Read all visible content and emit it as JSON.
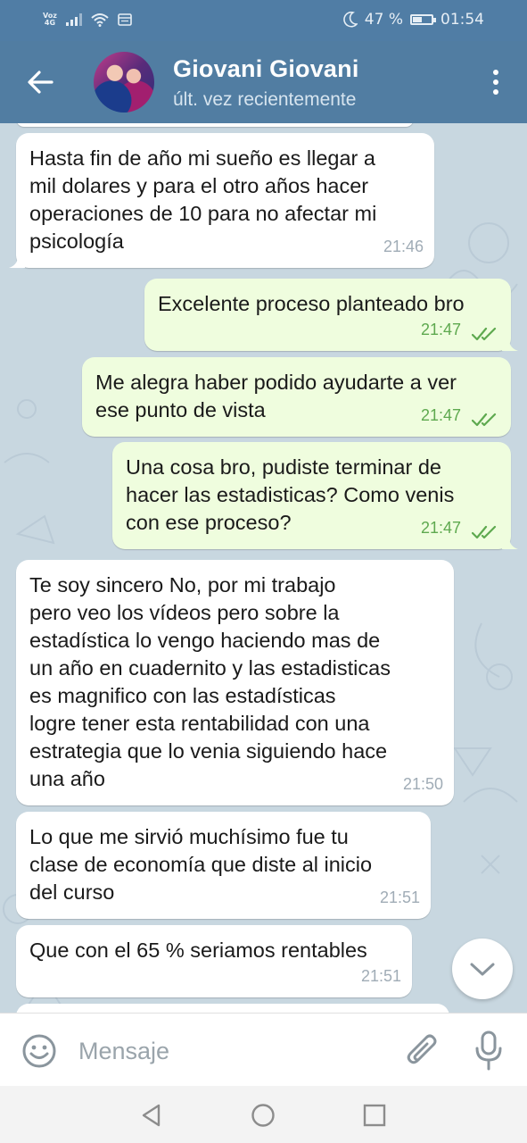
{
  "status_bar": {
    "volte_top": "Voz",
    "volte_bottom": "4G",
    "battery": "47 %",
    "time": "01:54"
  },
  "header": {
    "contact_name": "Giovani Giovani",
    "last_seen": "últ. vez recientemente"
  },
  "messages": [
    {
      "direction": "in",
      "text": "Hasta fin de año mi sueño es llegar a\nmil dolares y para el otro años hacer\noperaciones de 10 para no afectar mi\npsicología",
      "time": "21:46"
    },
    {
      "direction": "out",
      "text": "Excelente proceso planteado bro",
      "time": "21:47",
      "status": "read"
    },
    {
      "direction": "out",
      "text": "Me alegra haber podido ayudarte a ver\nese punto de vista",
      "time": "21:47",
      "status": "read"
    },
    {
      "direction": "out",
      "text": "Una cosa bro, pudiste terminar de\nhacer las estadisticas? Como venis\ncon ese proceso?",
      "time": "21:47",
      "status": "read"
    },
    {
      "direction": "in",
      "text": "Te soy sincero No, por mi trabajo\npero veo los vídeos pero sobre la\nestadística lo vengo haciendo mas de\nun año en cuadernito y las estadisticas\nes magnifico con las estadísticas\nlogre tener esta rentabilidad con una\nestrategia que lo venia siguiendo hace\nuna año",
      "time": "21:50"
    },
    {
      "direction": "in",
      "text": "Lo que me sirvió muchísimo fue tu\nclase de economía que diste al inicio\ndel curso",
      "time": "21:51"
    },
    {
      "direction": "in",
      "text": "Que con el 65 % seriamos rentables",
      "time": "21:51"
    }
  ],
  "input": {
    "placeholder": "Mensaje"
  },
  "colors": {
    "header": "#517da2",
    "status_bar": "#507da5",
    "chat_background": "#c8d7e0",
    "incoming_bubble": "#ffffff",
    "outgoing_bubble": "#effdde",
    "read_ticks": "#5ea94f"
  },
  "icons": {
    "back": "arrow-left-icon",
    "menu": "more-vertical-icon",
    "emoji": "smile-icon",
    "attach": "paperclip-icon",
    "mic": "microphone-icon",
    "scroll": "chevron-down-icon",
    "nav_back": "triangle-back-icon",
    "nav_home": "circle-home-icon",
    "nav_recents": "square-recents-icon"
  }
}
